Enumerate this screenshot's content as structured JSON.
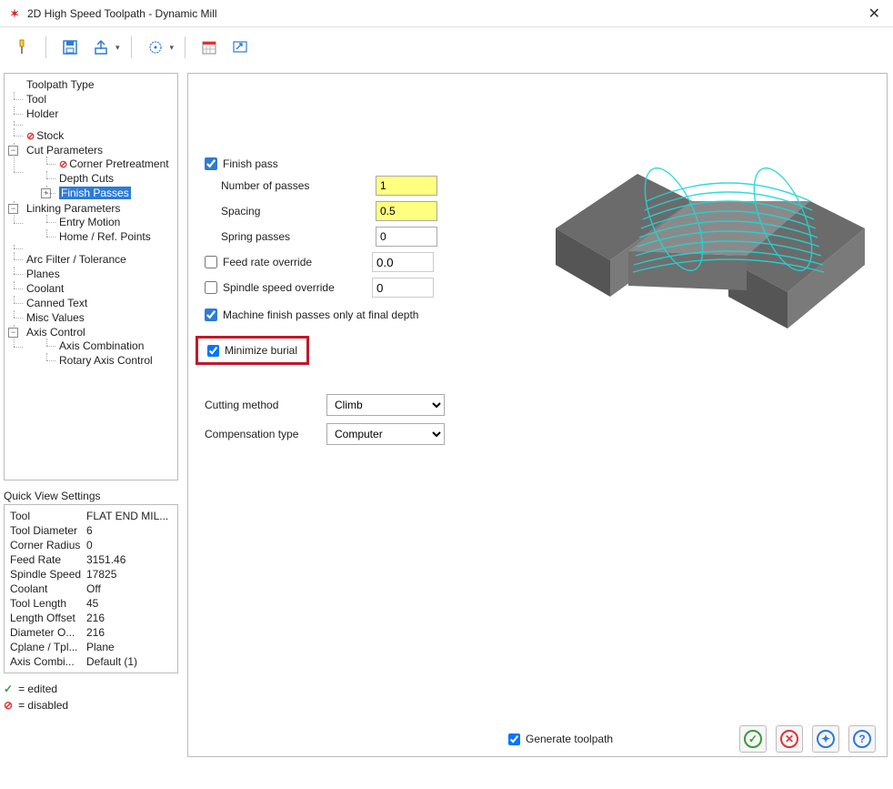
{
  "window": {
    "title": "2D High Speed Toolpath - Dynamic Mill"
  },
  "tree": {
    "toolpath_type": "Toolpath Type",
    "tool": "Tool",
    "holder": "Holder",
    "stock": "Stock",
    "cut_parameters": "Cut Parameters",
    "corner_pretreatment": "Corner Pretreatment",
    "depth_cuts": "Depth Cuts",
    "finish_passes": "Finish Passes",
    "linking_parameters": "Linking Parameters",
    "entry_motion": "Entry Motion",
    "home_ref": "Home / Ref. Points",
    "arc_filter": "Arc Filter / Tolerance",
    "planes": "Planes",
    "coolant": "Coolant",
    "canned_text": "Canned Text",
    "misc_values": "Misc Values",
    "axis_control": "Axis Control",
    "axis_combination": "Axis Combination",
    "rotary_axis": "Rotary Axis Control"
  },
  "form": {
    "finish_pass": "Finish pass",
    "number_of_passes": {
      "label": "Number of passes",
      "value": "1"
    },
    "spacing": {
      "label": "Spacing",
      "value": "0.5"
    },
    "spring_passes": {
      "label": "Spring passes",
      "value": "0"
    },
    "feed_override": {
      "label": "Feed rate override",
      "value": "0.0"
    },
    "spindle_override": {
      "label": "Spindle speed override",
      "value": "0"
    },
    "machine_final": "Machine finish passes only at final depth",
    "minimize_burial": "Minimize burial",
    "cutting_method": {
      "label": "Cutting method",
      "value": "Climb"
    },
    "compensation_type": {
      "label": "Compensation type",
      "value": "Computer"
    }
  },
  "qv": {
    "title": "Quick View Settings",
    "rows": {
      "tool": {
        "k": "Tool",
        "v": "FLAT END MIL..."
      },
      "diameter": {
        "k": "Tool Diameter",
        "v": "6"
      },
      "corner_radius": {
        "k": "Corner Radius",
        "v": "0"
      },
      "feed_rate": {
        "k": "Feed Rate",
        "v": "3151.46"
      },
      "spindle_speed": {
        "k": "Spindle Speed",
        "v": "17825"
      },
      "coolant": {
        "k": "Coolant",
        "v": "Off"
      },
      "tool_length": {
        "k": "Tool Length",
        "v": "45"
      },
      "length_offset": {
        "k": "Length Offset",
        "v": "216"
      },
      "diameter_o": {
        "k": "Diameter O...",
        "v": "216"
      },
      "cplane": {
        "k": "Cplane / Tpl...",
        "v": "Plane"
      },
      "axis_combi": {
        "k": "Axis Combi...",
        "v": "Default (1)"
      }
    }
  },
  "legend": {
    "edited": "= edited",
    "disabled": "= disabled"
  },
  "footer": {
    "generate": "Generate toolpath"
  }
}
